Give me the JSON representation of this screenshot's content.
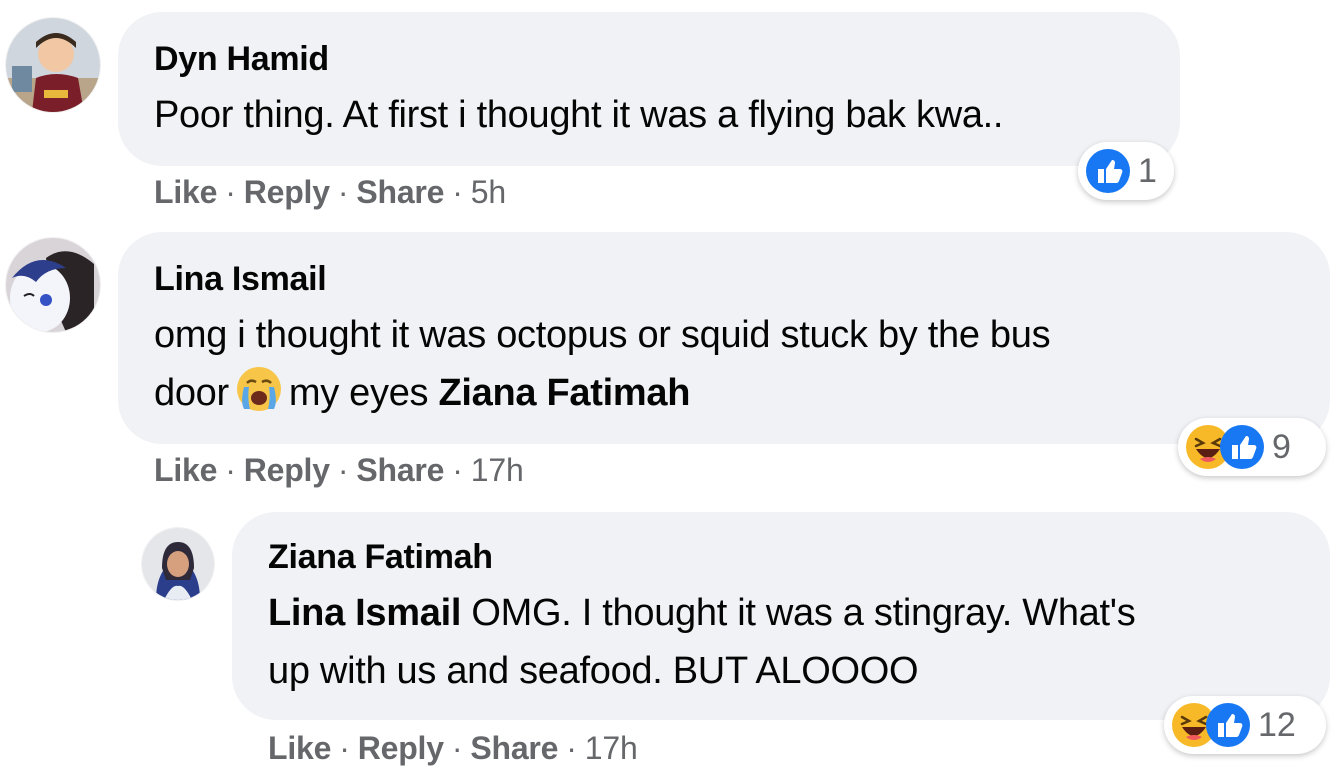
{
  "comments": [
    {
      "author": "Dyn Hamid",
      "text": "Poor thing. At first i thought it was a flying bak kwa..",
      "actions": {
        "like": "Like",
        "reply": "Reply",
        "share": "Share",
        "sep": "·",
        "time": "5h"
      },
      "reactions": {
        "icons": [
          "like-icon"
        ],
        "count": "1"
      }
    },
    {
      "author": "Lina Ismail",
      "text_line1": "omg i thought it was octopus or squid stuck by the bus",
      "text_line2_pre": "door",
      "emoji": "crying-face-emoji",
      "text_line2_post": "my eyes",
      "mention": "Ziana Fatimah",
      "actions": {
        "like": "Like",
        "reply": "Reply",
        "share": "Share",
        "sep": "·",
        "time": "17h"
      },
      "reactions": {
        "icons": [
          "haha-icon",
          "like-icon"
        ],
        "count": "9"
      }
    },
    {
      "author": "Ziana Fatimah",
      "mention": "Lina Ismail",
      "text_line1": "OMG. I thought it was a stingray. What's",
      "text_line2": "up with us and seafood. BUT ALOOOO",
      "actions": {
        "like": "Like",
        "reply": "Reply",
        "share": "Share",
        "sep": "·",
        "time": "17h"
      },
      "reactions": {
        "icons": [
          "haha-icon",
          "like-icon"
        ],
        "count": "12"
      }
    }
  ],
  "colors": {
    "bubble": "#f0f2f5",
    "text": "#050505",
    "meta": "#65676b",
    "like_blue": "#1877f2",
    "haha_yellow": "#f7b928"
  }
}
